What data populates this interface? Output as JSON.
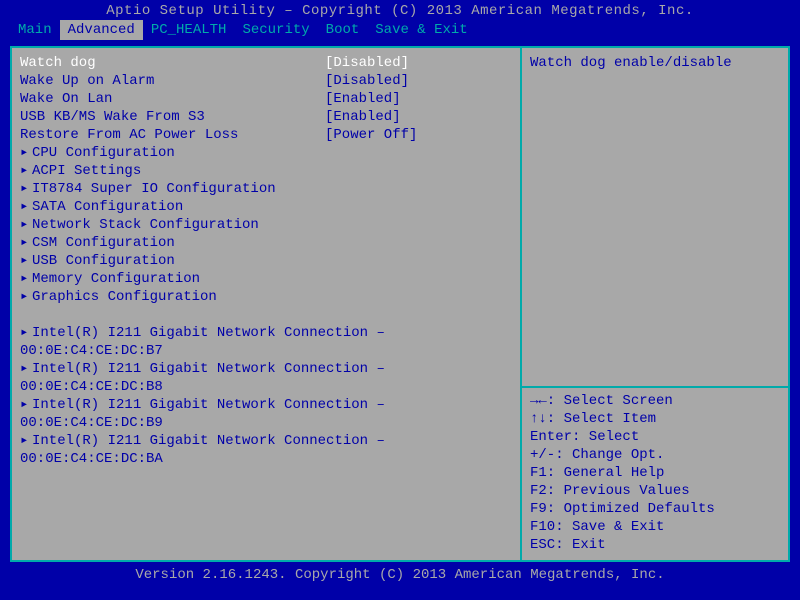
{
  "title": "Aptio Setup Utility – Copyright (C) 2013 American Megatrends, Inc.",
  "footer": "Version 2.16.1243. Copyright (C) 2013 American Megatrends, Inc.",
  "tabs": [
    "Main",
    "Advanced",
    "PC_HEALTH",
    "Security",
    "Boot",
    "Save & Exit"
  ],
  "activeTab": "Advanced",
  "settings": [
    {
      "label": "Watch dog",
      "value": "[Disabled]",
      "selected": true
    },
    {
      "label": "Wake Up on Alarm",
      "value": "[Disabled]"
    },
    {
      "label": "Wake On Lan",
      "value": "[Enabled]"
    },
    {
      "label": "USB KB/MS Wake From S3",
      "value": "[Enabled]"
    },
    {
      "label": "Restore From AC Power Loss",
      "value": "[Power Off]"
    }
  ],
  "submenus": [
    "CPU Configuration",
    "ACPI Settings",
    "IT8784 Super IO Configuration",
    "SATA Configuration",
    "Network Stack Configuration",
    "CSM Configuration",
    "USB Configuration",
    "Memory Configuration",
    "Graphics Configuration"
  ],
  "networkConnections": [
    {
      "name": "Intel(R) I211 Gigabit  Network Connection –",
      "mac": "00:0E:C4:CE:DC:B7"
    },
    {
      "name": "Intel(R) I211 Gigabit  Network Connection –",
      "mac": "00:0E:C4:CE:DC:B8"
    },
    {
      "name": "Intel(R) I211 Gigabit  Network Connection –",
      "mac": "00:0E:C4:CE:DC:B9"
    },
    {
      "name": "Intel(R) I211 Gigabit  Network Connection –",
      "mac": "00:0E:C4:CE:DC:BA"
    }
  ],
  "helpText": "Watch dog enable/disable",
  "keyHints": [
    "→←: Select Screen",
    "↑↓: Select Item",
    "Enter: Select",
    "+/-: Change Opt.",
    "F1: General Help",
    "F2: Previous Values",
    "F9: Optimized Defaults",
    "F10: Save & Exit",
    "ESC: Exit"
  ]
}
